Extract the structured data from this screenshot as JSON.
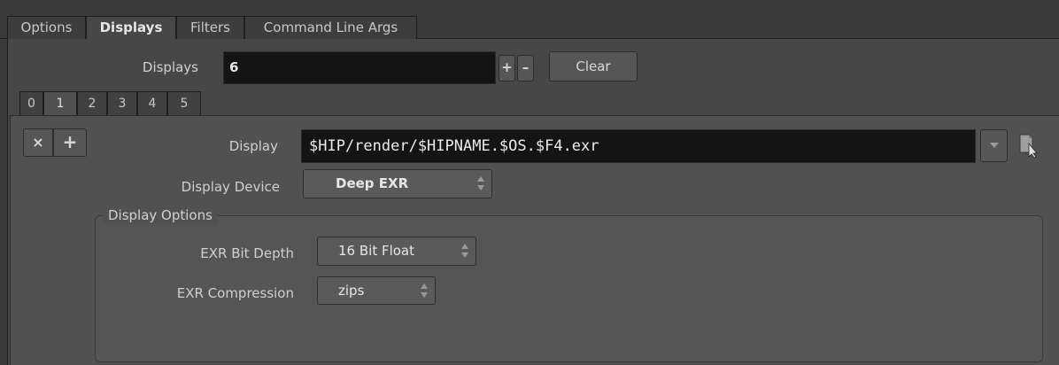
{
  "tabs": [
    {
      "label": "Options"
    },
    {
      "label": "Displays"
    },
    {
      "label": "Filters"
    },
    {
      "label": "Command Line Args"
    }
  ],
  "displays": {
    "label": "Displays",
    "value": "6",
    "plus": "+",
    "minus": "–",
    "clear_label": "Clear"
  },
  "subtabs": [
    "0",
    "1",
    "2",
    "3",
    "4",
    "5"
  ],
  "display_item": {
    "remove_label": "×",
    "insert_label": "+",
    "display_label": "Display",
    "display_value": "$HIP/render/$HIPNAME.$OS.$F4.exr",
    "device_label": "Display Device",
    "device_value": "Deep EXR"
  },
  "display_options": {
    "caption": "Display Options",
    "bitdepth_label": "EXR Bit Depth",
    "bitdepth_value": "16 Bit Float",
    "compression_label": "EXR Compression",
    "compression_value": "zips"
  },
  "colors": {
    "field_bg": "#141414",
    "panel_bg": "#515151"
  }
}
